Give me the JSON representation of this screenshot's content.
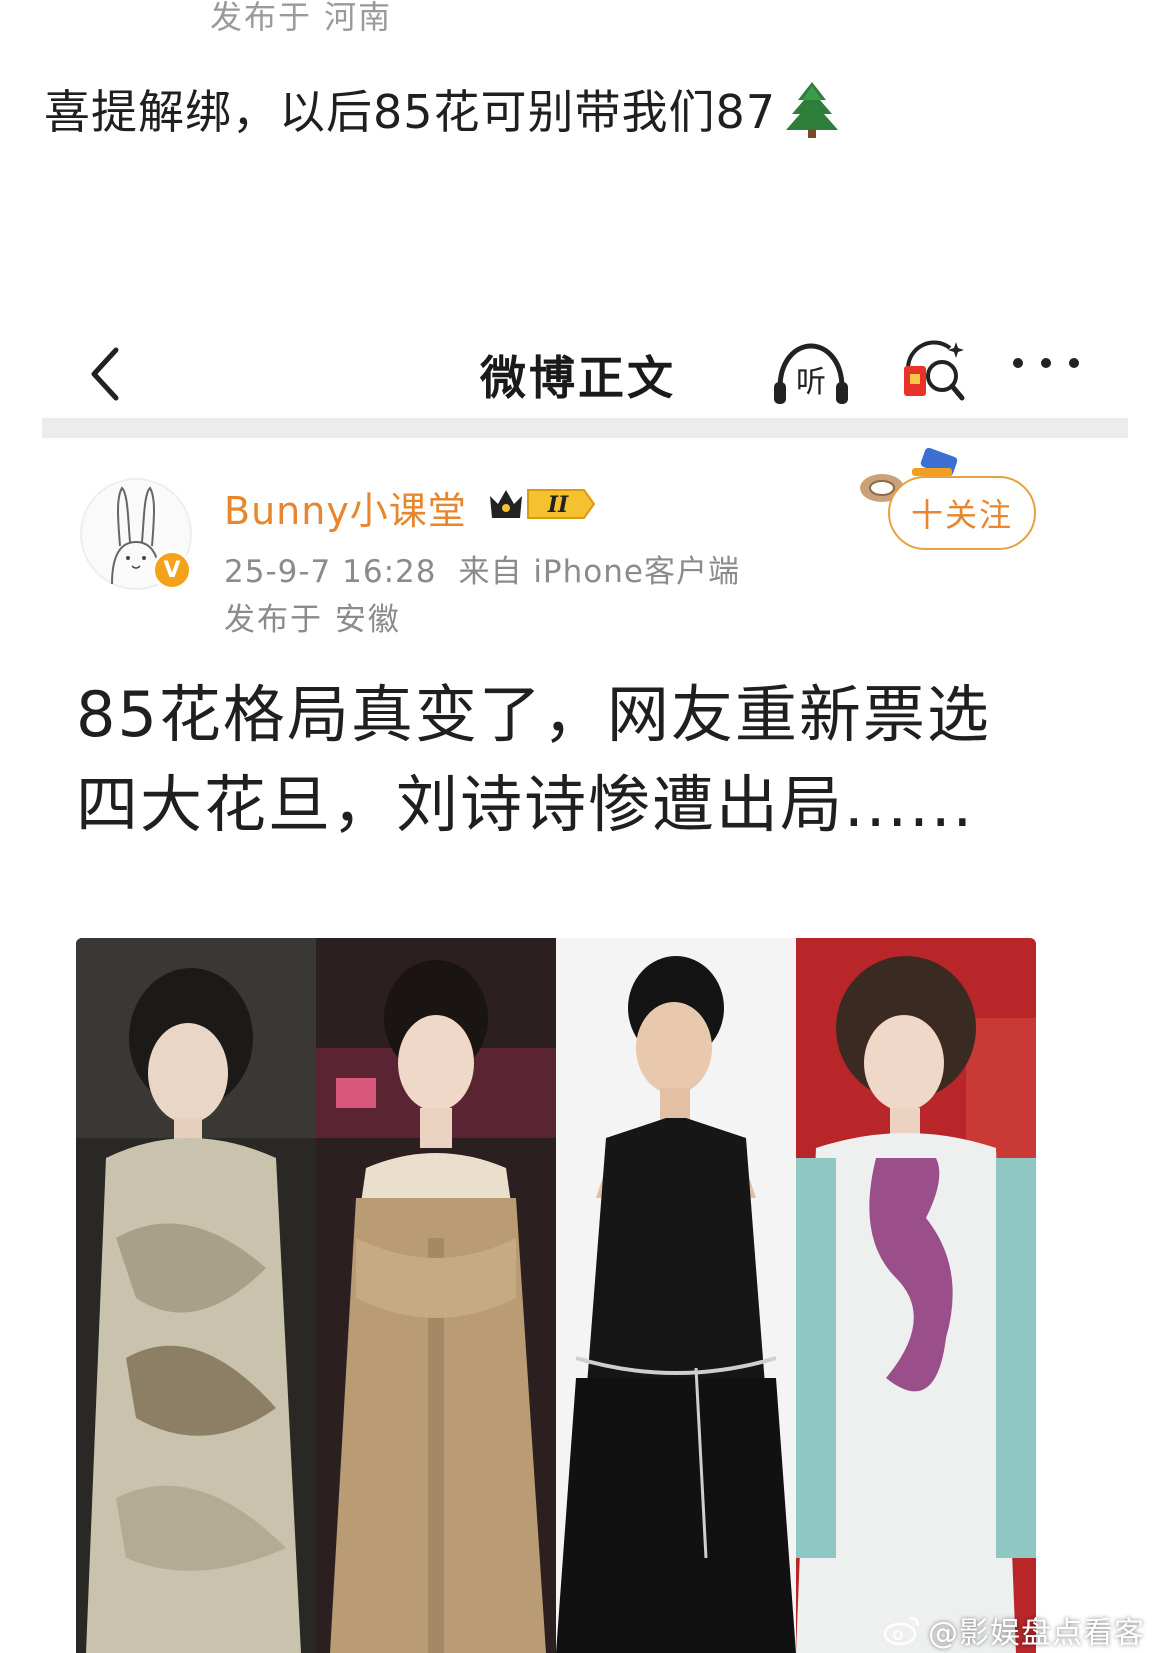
{
  "outer_post": {
    "location": "发布于 河南",
    "text": "喜提解绑，以后85花可别带我们87"
  },
  "screenshot": {
    "topbar": {
      "title": "微博正文",
      "listen_label": "听"
    },
    "author": {
      "name": "Bunny小课堂",
      "verified_badge": "V",
      "level_badge": "II",
      "date": "25-9-7 16:28",
      "source": "来自 iPhone客户端",
      "location": "发布于 安徽",
      "follow_label": "十关注"
    },
    "post": {
      "title": "85花格局真变了，网友重新票选四大花旦，刘诗诗惨遭出局......"
    }
  },
  "watermark": {
    "text": "@影娱盘点看客"
  },
  "colors": {
    "accent_orange": "#e8862d",
    "meta_gray": "#8b8b8b",
    "verified_gold": "#f4a21a"
  },
  "icons": [
    "tree-icon",
    "back-icon",
    "listen-icon",
    "redpacket-icon",
    "more-icon",
    "crown-badge-icon",
    "weibo-icon"
  ]
}
